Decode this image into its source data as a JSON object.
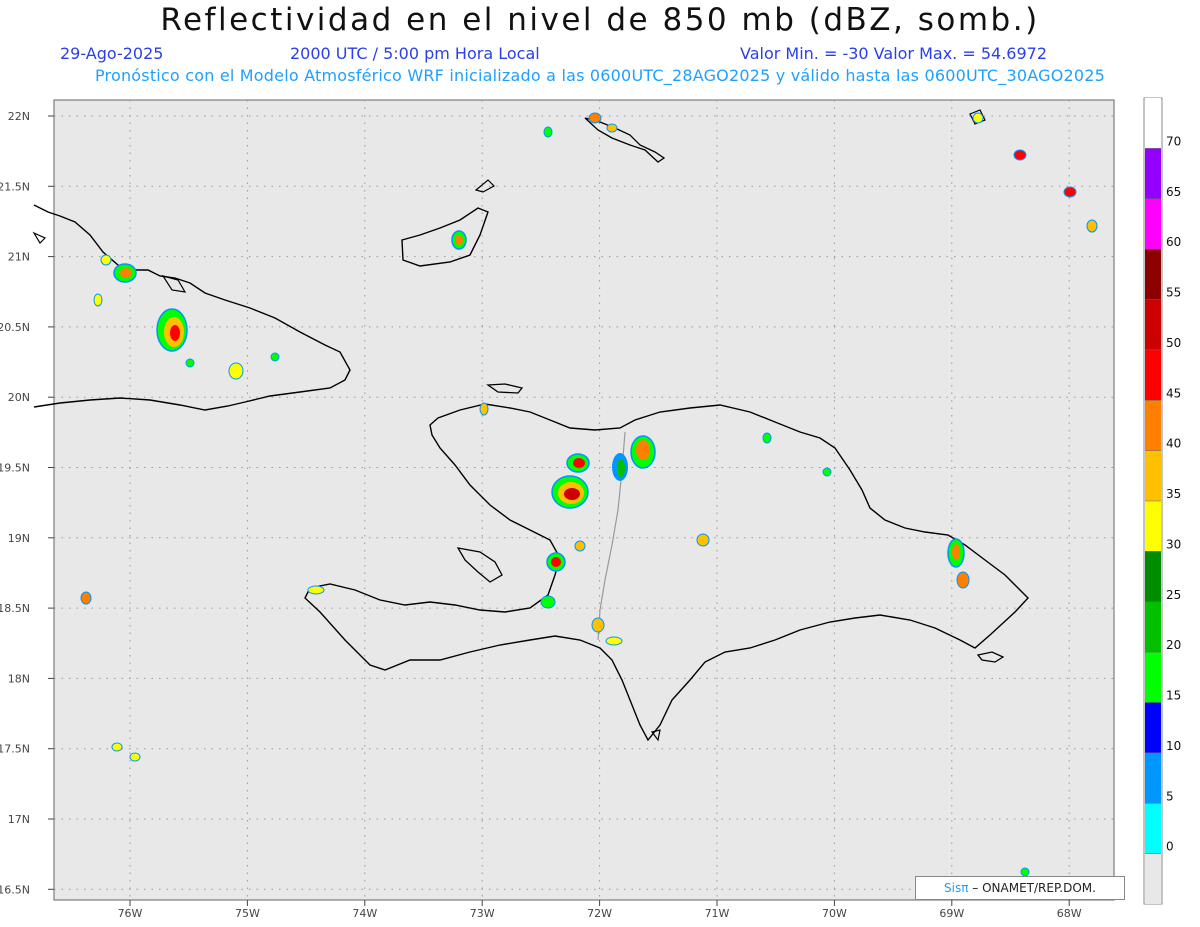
{
  "header": {
    "title": "Reflectividad en el nivel de 850 mb (dBZ, somb.)",
    "date": "29-Ago-2025",
    "time": "2000 UTC / 5:00 pm Hora Local",
    "minmax": "Valor Min. = -30  Valor Max. = 54.6972",
    "description": "Pronóstico con el Modelo Atmosférico WRF inicializado a las 0600UTC_28AGO2025 y válido hasta las  0600UTC_30AGO2025"
  },
  "axes": {
    "lat_labels": [
      "22N",
      "21.5N",
      "21N",
      "20.5N",
      "20N",
      "19.5N",
      "19N",
      "18.5N",
      "18N",
      "17.5N",
      "17N",
      "16.5N"
    ],
    "lon_labels": [
      "76W",
      "75W",
      "74W",
      "73W",
      "72W",
      "71W",
      "70W",
      "69W",
      "68W"
    ]
  },
  "colorbar": {
    "labels": [
      "70",
      "65",
      "60",
      "55",
      "50",
      "45",
      "40",
      "35",
      "30",
      "25",
      "20",
      "15",
      "10",
      "5",
      "0"
    ],
    "colors": [
      "#ffffff",
      "#9400ff",
      "#ff00ff",
      "#8c0000",
      "#cc0000",
      "#ff0000",
      "#ff7f00",
      "#ffc000",
      "#ffff00",
      "#008c00",
      "#00c000",
      "#00ff00",
      "#0000ff",
      "#0096ff",
      "#00ffff",
      "#e8e8e8"
    ]
  },
  "credit": {
    "logo": "Sisπ",
    "text": "– ONAMET/REP.DOM."
  },
  "colors": {
    "map_background": "#e8e8e8",
    "grid": "#888888",
    "coast": "#000000",
    "provinces": "#a8a8a8"
  }
}
